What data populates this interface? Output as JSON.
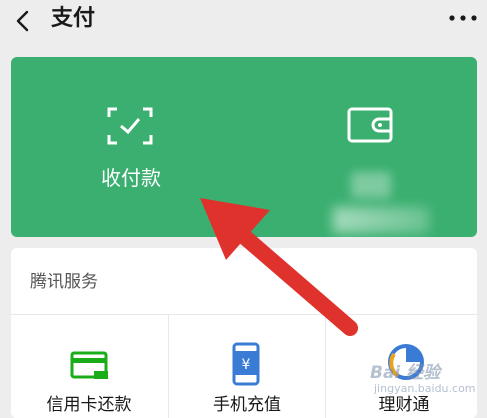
{
  "header": {
    "title": "支付"
  },
  "pay_card": {
    "collect_pay_label": "收付款"
  },
  "services": {
    "title": "腾讯服务",
    "items": [
      {
        "label": "信用卡还款",
        "icon": "credit-card-icon"
      },
      {
        "label": "手机充值",
        "icon": "phone-recharge-icon"
      },
      {
        "label": "理财通",
        "icon": "licaitong-icon"
      }
    ]
  },
  "watermark": {
    "text": "Bai 经验",
    "sub": "jingyan.baidu.com"
  },
  "colors": {
    "green_card": "#3aaf6f",
    "background": "#ededed",
    "arrow": "#e0322c",
    "service_icon_green": "#1aad19",
    "service_icon_blue": "#3a7bd5"
  }
}
